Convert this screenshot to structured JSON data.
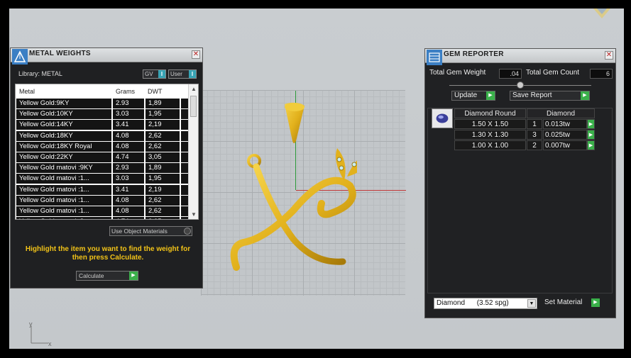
{
  "metal_weights": {
    "title": "METAL WEIGHTS",
    "library_label": "Library: METAL",
    "gv_label": "GV",
    "user_label": "User",
    "toggle_glyph": "I",
    "columns": [
      "Metal",
      "Grams",
      "DWT"
    ],
    "rows": [
      {
        "metal": "Yellow Gold:9KY",
        "grams": "2.93",
        "dwt": "1,89"
      },
      {
        "metal": "Yellow Gold:10KY",
        "grams": "3.03",
        "dwt": "1,95"
      },
      {
        "metal": "Yellow Gold:14KY",
        "grams": "3.41",
        "dwt": "2,19"
      },
      {
        "metal": "Yellow Gold:18KY",
        "grams": "4.08",
        "dwt": "2,62"
      },
      {
        "metal": "Yellow Gold:18KY Royal",
        "grams": "4.08",
        "dwt": "2,62"
      },
      {
        "metal": "Yellow Gold:22KY",
        "grams": "4.74",
        "dwt": "3,05"
      },
      {
        "metal": "Yellow Gold matovi :9KY",
        "grams": "2.93",
        "dwt": "1,89"
      },
      {
        "metal": "Yellow Gold matovi :1...",
        "grams": "3.03",
        "dwt": "1,95"
      },
      {
        "metal": "Yellow Gold matovi :1...",
        "grams": "3.41",
        "dwt": "2,19"
      },
      {
        "metal": "Yellow Gold matovi :1...",
        "grams": "4.08",
        "dwt": "2,62"
      },
      {
        "metal": "Yellow Gold matovi :1...",
        "grams": "4.08",
        "dwt": "2,62"
      },
      {
        "metal": "Yellow Gold matovi :2...",
        "grams": "4.74",
        "dwt": "3,05"
      }
    ],
    "use_object_materials": "Use Object Materials",
    "hint": "Highlight the item you want to find the weight for then press Calculate.",
    "calculate_label": "Calculate"
  },
  "gem_reporter": {
    "title": "GEM REPORTER",
    "total_weight_label": "Total Gem Weight",
    "total_weight_value": ".04",
    "total_count_label": "Total Gem Count",
    "total_count_value": "6",
    "update_label": "Update",
    "save_report_label": "Save Report",
    "table_headers": [
      "Diamond Round",
      "Diamond"
    ],
    "rows": [
      {
        "size": "1.50 X 1.50",
        "count": "1",
        "weight": "0.013tw"
      },
      {
        "size": "1.30 X 1.30",
        "count": "3",
        "weight": "0.025tw"
      },
      {
        "size": "1.00 X 1.00",
        "count": "2",
        "weight": "0.007tw"
      }
    ],
    "material_select": "Diamond      (3.52 spg)",
    "set_material_label": "Set Material"
  },
  "viewport": {
    "triad_y": "y",
    "triad_x": "x"
  },
  "colors": {
    "gold": "#e2b11c",
    "hint_yellow": "#f2c318",
    "go_green": "#3ab04a",
    "toggle_teal": "#37a2b3"
  }
}
